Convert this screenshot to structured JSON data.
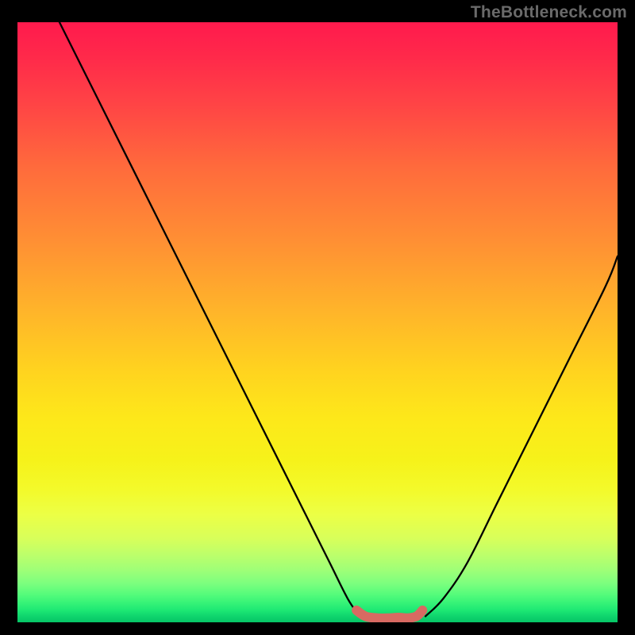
{
  "watermark": "TheBottleneck.com",
  "chart_data": {
    "type": "line",
    "title": "",
    "xlabel": "",
    "ylabel": "",
    "xlim": [
      0,
      100
    ],
    "ylim": [
      0,
      100
    ],
    "series": [
      {
        "name": "left-arc",
        "x": [
          7,
          12,
          18,
          24,
          30,
          36,
          42,
          48,
          52,
          55,
          57
        ],
        "values": [
          100,
          90,
          78,
          66,
          54,
          42,
          30,
          18,
          10,
          4,
          1
        ]
      },
      {
        "name": "right-arc",
        "x": [
          68,
          71,
          75,
          80,
          86,
          92,
          98,
          100
        ],
        "values": [
          1,
          4,
          10,
          20,
          32,
          44,
          56,
          61
        ]
      },
      {
        "name": "bottom-band",
        "x": [
          56.5,
          58,
          60,
          62,
          63.5,
          65,
          66.5,
          67.5
        ],
        "values": [
          2.0,
          1.0,
          0.7,
          0.7,
          0.8,
          0.7,
          1.0,
          2.0
        ]
      }
    ],
    "annotations": []
  }
}
